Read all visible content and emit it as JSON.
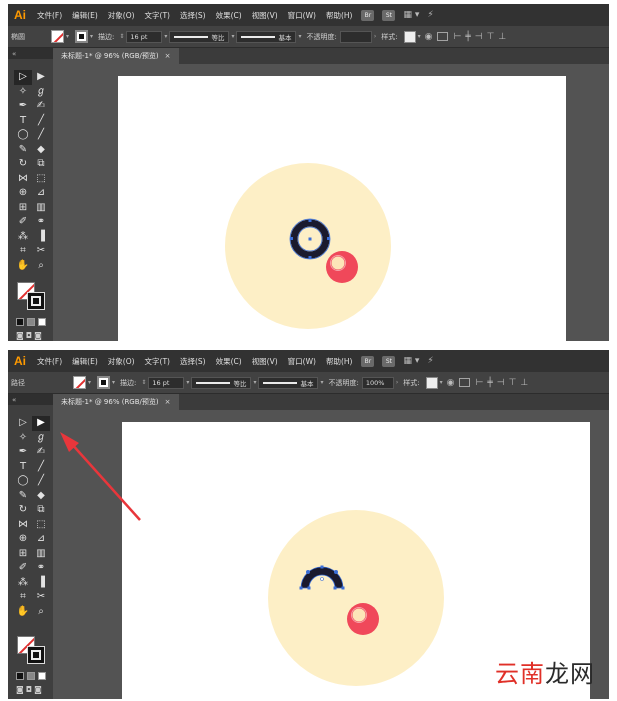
{
  "app": {
    "logo": "Ai"
  },
  "menus": [
    "文件(F)",
    "编辑(E)",
    "对象(O)",
    "文字(T)",
    "选择(S)",
    "效果(C)",
    "视图(V)",
    "窗口(W)",
    "帮助(H)"
  ],
  "bridge_badges": [
    "Br",
    "St"
  ],
  "screens": [
    {
      "selection_label": "椭圆",
      "stroke_label": "描边:",
      "stroke_weight": "16 pt",
      "profile_label": "等比",
      "brush_label": "基本",
      "opacity_label": "不透明度:",
      "opacity_value": "",
      "style_label": "样式:",
      "doc_tab": "未标题-1* @ 96% (RGB/预览)",
      "tab_close": "×",
      "active_tool": "selection"
    },
    {
      "selection_label": "路径",
      "stroke_label": "描边:",
      "stroke_weight": "16 pt",
      "profile_label": "等比",
      "brush_label": "基本",
      "opacity_label": "不透明度:",
      "opacity_value": "100%",
      "style_label": "样式:",
      "doc_tab": "未标题-1* @ 96% (RGB/预览)",
      "tab_close": "×",
      "active_tool": "direct-selection"
    }
  ],
  "colors": {
    "canvas_bg": "#535353",
    "circle_fill": "#fdefc6",
    "ring_stroke": "#1a1a2e",
    "ball_red": "#f0485a",
    "ball_highlight": "#fde5b8",
    "selection_blue": "#3a6ed8",
    "arrow_red": "#e8363b"
  },
  "watermark": {
    "part1": "云南",
    "part2": "龙网"
  }
}
